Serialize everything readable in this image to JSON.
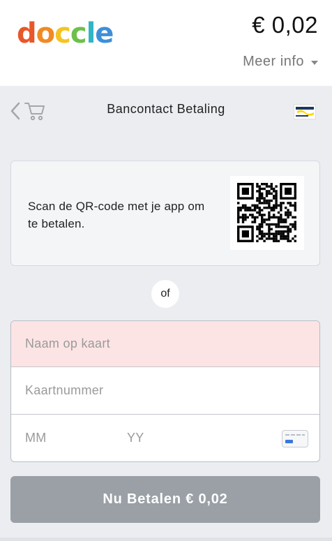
{
  "brand": {
    "letters": [
      "d",
      "o",
      "c",
      "c",
      "l",
      "e"
    ],
    "letter_colors": [
      "#e8572a",
      "#f08a24",
      "#f5c423",
      "#6cc04a",
      "#2fb5c4",
      "#3d8fd8"
    ]
  },
  "header": {
    "amount": "€ 0,02",
    "meer_info_label": "Meer info"
  },
  "nav": {
    "back_icon": "chevron-left-icon",
    "cart_icon": "cart-icon",
    "title": "Bancontact Betaling",
    "payment_logo": "bancontact-logo"
  },
  "qr": {
    "text": "Scan de QR-code met je app om te betalen."
  },
  "separator": {
    "label": "of"
  },
  "form": {
    "name_placeholder": "Naam op kaart",
    "number_placeholder": "Kaartnummer",
    "month_placeholder": "MM",
    "year_placeholder": "YY"
  },
  "pay_button": {
    "label": "Nu Betalen € 0,02"
  },
  "colors": {
    "accent_disabled": "#9aa0a6",
    "error_field_bg": "#fde4e4",
    "page_bg": "#ebedf1"
  }
}
